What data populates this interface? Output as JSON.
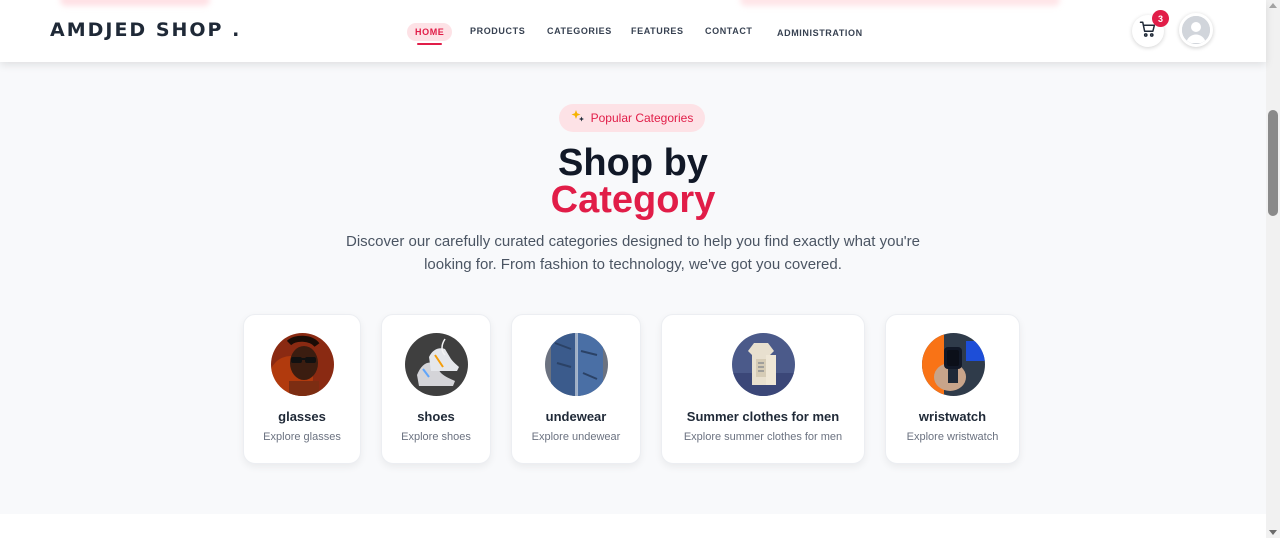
{
  "brand": "AMDJED SHOP .",
  "nav": {
    "links": [
      "HOME",
      "PRODUCTS",
      "CATEGORIES",
      "FEATURES",
      "CONTACT",
      "ADMINISTRATION"
    ],
    "active": "HOME",
    "cart_count": "3"
  },
  "hero": {
    "badge": "Popular Categories",
    "badge_icon": "sparkle-icon",
    "title_line1": "Shop by",
    "title_line2": "Category",
    "subtitle": "Discover our carefully curated categories designed to help you find exactly what you're looking for. From fashion to technology, we've got you covered."
  },
  "categories": [
    {
      "name": "glasses",
      "sub": "Explore glasses"
    },
    {
      "name": "shoes",
      "sub": "Explore shoes"
    },
    {
      "name": "undewear",
      "sub": "Explore undewear"
    },
    {
      "name": "Summer clothes for men",
      "sub": "Explore summer clothes for men"
    },
    {
      "name": "wristwatch",
      "sub": "Explore wristwatch"
    }
  ],
  "colors": {
    "accent": "#e11d48",
    "accent_soft": "#fde2e6",
    "heading": "#111827"
  }
}
